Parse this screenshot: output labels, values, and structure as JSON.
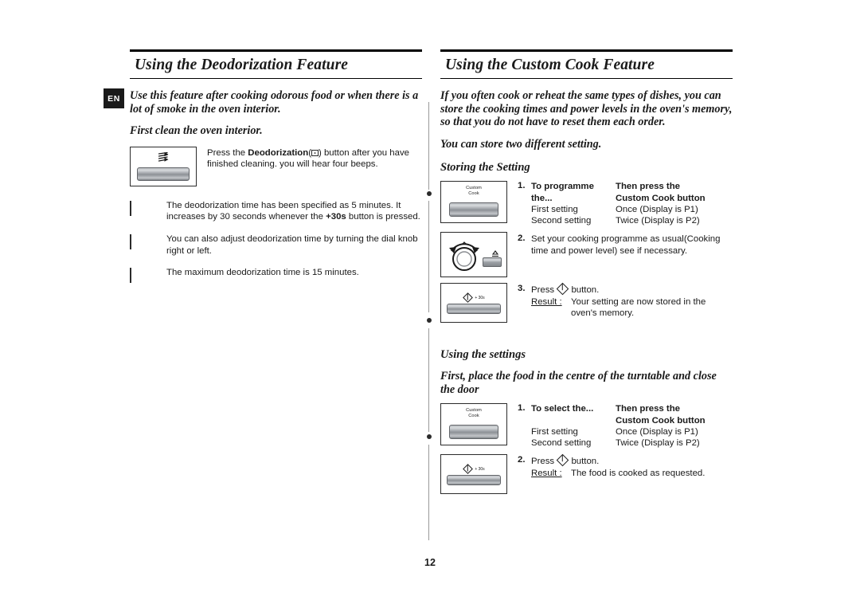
{
  "page": {
    "number": "12",
    "language_tag": "EN"
  },
  "left": {
    "heading": "Using the Deodorization Feature",
    "intro_1": "Use this feature after cooking odorous food or when there is a lot of smoke in the oven interior.",
    "intro_2": "First clean the oven interior.",
    "press_instruction_pre": "Press the ",
    "press_instruction_bold": "Deodorization",
    "press_instruction_post": ") button after you have finished cleaning. you will hear four beeps.",
    "illustration_icon": "deodorization-waves-icon",
    "notes": [
      "The deodorization time has been specified as 5 minutes. It increases by 30 seconds whenever the +30s button is pressed.",
      "You can also adjust deodorization time by turning the dial knob right or left.",
      "The maximum deodorization time is 15 minutes."
    ],
    "note_1_plain_a": "The deodorization time has been specified as 5 minutes. It increases by 30 seconds whenever the ",
    "note_1_bold": "+30s",
    "note_1_plain_b": " button is pressed."
  },
  "right": {
    "heading": "Using the Custom Cook Feature",
    "intro_1": "If you often cook or reheat the same types of dishes, you can store the cooking times and power levels in the oven's memory, so that you do not have to reset them each order.",
    "intro_2": "You can store two different setting.",
    "storing": {
      "sub_heading": "Storing the Setting",
      "steps": [
        {
          "number": "1.",
          "table": {
            "header_left": "To programme the...",
            "header_right_line1": "Then press the",
            "header_right_line2": "Custom Cook button",
            "rows": [
              {
                "left": "First setting",
                "right": "Once (Display is P1)"
              },
              {
                "left": "Second setting",
                "right": "Twice (Display is P2)"
              }
            ]
          },
          "illustration": {
            "cap_line1": "Custom",
            "cap_line2": "Cook",
            "icon": "custom-cook-button-icon"
          }
        },
        {
          "number": "2.",
          "text": "Set your cooking programme as usual(Cooking time and power level) see if necessary.",
          "illustration": {
            "icon": "dial-knob-icon"
          }
        },
        {
          "number": "3.",
          "text_pre": "Press ",
          "text_post": " button.",
          "result_label": "Result :",
          "result_text": "Your setting are now stored in the oven's memory.",
          "illustration": {
            "cap": "+ 30s",
            "icon": "start-plus-30s-button-icon"
          }
        }
      ]
    },
    "using": {
      "sub_heading": "Using the settings",
      "lead": "First, place the food in the centre of the turntable and close the door",
      "steps": [
        {
          "number": "1.",
          "table": {
            "header_left": "To select the...",
            "header_right_line1": "Then press the",
            "header_right_line2": "Custom Cook button",
            "rows": [
              {
                "left": "First setting",
                "right": "Once (Display is P1)"
              },
              {
                "left": "Second setting",
                "right": "Twice (Display is P2)"
              }
            ]
          },
          "illustration": {
            "cap_line1": "Custom",
            "cap_line2": "Cook",
            "icon": "custom-cook-button-icon"
          }
        },
        {
          "number": "2.",
          "text_pre": "Press ",
          "text_post": " button.",
          "result_label": "Result :",
          "result_text": "The food is cooked as requested.",
          "illustration": {
            "cap": "+ 30s",
            "icon": "start-plus-30s-button-icon"
          }
        }
      ]
    }
  }
}
